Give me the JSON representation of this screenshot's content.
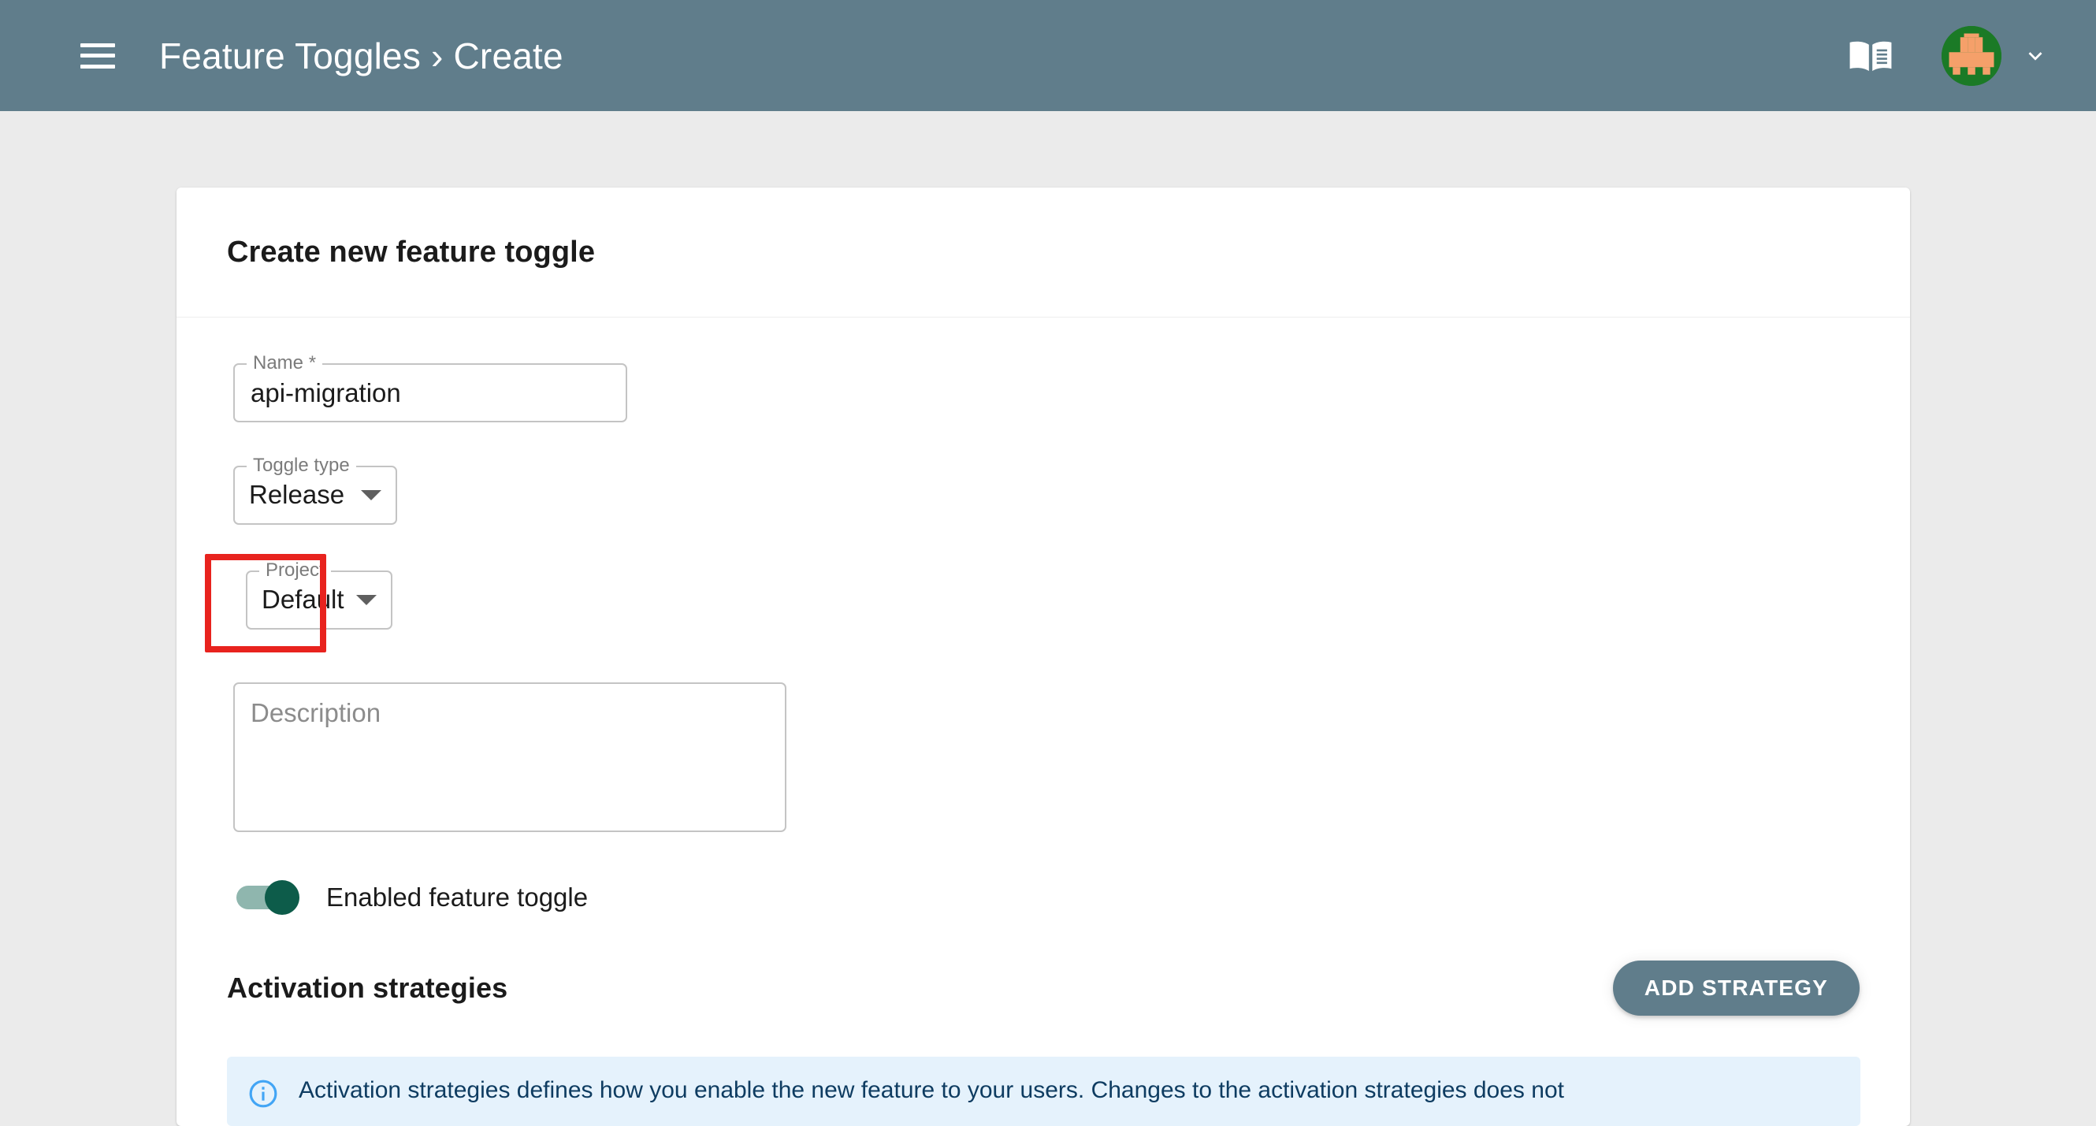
{
  "appbar": {
    "menu_icon": "hamburger-menu-icon",
    "breadcrumb": "Feature Toggles › Create",
    "docs_icon": "book-icon",
    "avatar_icon": "user-avatar",
    "dropdown_icon": "chevron-down-icon",
    "background_color": "#607d8b"
  },
  "card": {
    "title": "Create new feature toggle"
  },
  "form": {
    "name": {
      "label": "Name *",
      "value": "api-migration",
      "placeholder": ""
    },
    "toggle_type": {
      "label": "Toggle type",
      "value": "Release"
    },
    "project": {
      "label": "Project",
      "value": "Default",
      "highlighted": true,
      "highlight_color": "#e8231e"
    },
    "description": {
      "label": "",
      "value": "",
      "placeholder": "Description"
    },
    "enabled_toggle": {
      "label": "Enabled feature toggle",
      "checked": true,
      "track_color": "#8fb6ae",
      "thumb_color": "#0d5c4a"
    }
  },
  "strategies": {
    "title": "Activation strategies",
    "add_button_label": "ADD STRATEGY",
    "add_button_color": "#607d8b"
  },
  "alert": {
    "icon": "info-circle-icon",
    "text": "Activation strategies defines how you enable the new feature to your users. Changes to the activation strategies does not",
    "background_color": "#e5f2fc",
    "text_color": "#0e3c61"
  }
}
